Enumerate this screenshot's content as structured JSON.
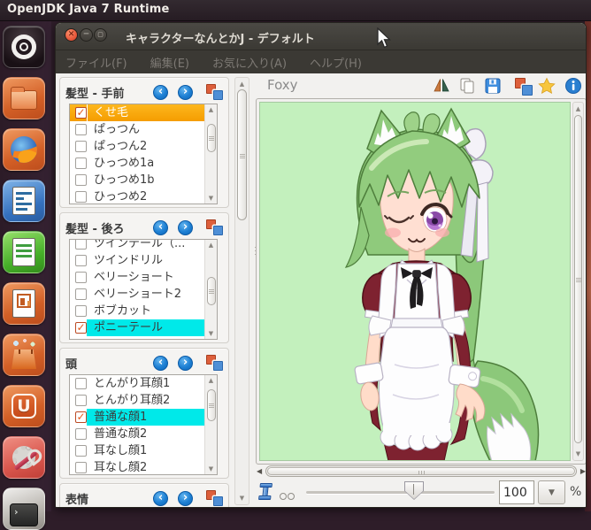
{
  "desktop": {
    "top_bar_title": "OpenJDK Java 7 Runtime",
    "dock_items": [
      "ubuntu-dash",
      "files",
      "firefox",
      "libreoffice-writer",
      "libreoffice-calc",
      "libreoffice-impress",
      "software-center",
      "ubuntu-one",
      "system-settings",
      "terminal"
    ]
  },
  "window": {
    "title": "キャラクターなんとかJ - デフォルト",
    "controls": [
      "close",
      "minimize",
      "maximize"
    ],
    "menus": [
      {
        "label": "ファイル(F)"
      },
      {
        "label": "編集(E)"
      },
      {
        "label": "お気に入り(A)"
      },
      {
        "label": "ヘルプ(H)"
      }
    ]
  },
  "sections": [
    {
      "title": "髪型 - 手前",
      "items": [
        {
          "label": "くせ毛",
          "checked": true,
          "sel": "sel-orange"
        },
        {
          "label": "ぱっつん",
          "checked": false
        },
        {
          "label": "ぱっつん2",
          "checked": false
        },
        {
          "label": "ひっつめ1a",
          "checked": false
        },
        {
          "label": "ひっつめ1b",
          "checked": false
        },
        {
          "label": "ひっつめ2",
          "checked": false
        }
      ]
    },
    {
      "title": "髪型 - 後ろ",
      "items": [
        {
          "label": "ツインテール（...",
          "checked": false
        },
        {
          "label": "ツインドリル",
          "checked": false
        },
        {
          "label": "ベリーショート",
          "checked": false
        },
        {
          "label": "ベリーショート2",
          "checked": false
        },
        {
          "label": "ボブカット",
          "checked": false
        },
        {
          "label": "ポニーテール",
          "checked": true,
          "sel": "sel-cyan"
        }
      ]
    },
    {
      "title": "頭",
      "items": [
        {
          "label": "とんがり耳顔1",
          "checked": false
        },
        {
          "label": "とんがり耳顔2",
          "checked": false
        },
        {
          "label": "普通な顔1",
          "checked": true,
          "sel": "sel-cyan"
        },
        {
          "label": "普通な顔2",
          "checked": false
        },
        {
          "label": "耳なし顔1",
          "checked": false
        },
        {
          "label": "耳なし顔2",
          "checked": false
        }
      ]
    },
    {
      "title": "表情",
      "items": []
    }
  ],
  "preview": {
    "tab_label": "Foxy",
    "toolbar_icons": [
      "flip-horizontal",
      "copy-pages",
      "save",
      "duplicate",
      "favorite",
      "info"
    ],
    "zoom_value": "100",
    "zoom_unit": "%"
  },
  "colors": {
    "selection_orange": "#f7a60b",
    "selection_cyan": "#00e9e9",
    "preview_background": "#c3f0bd",
    "nav_button_blue": "#1d7fd3",
    "titlebar": "#3b3934"
  }
}
